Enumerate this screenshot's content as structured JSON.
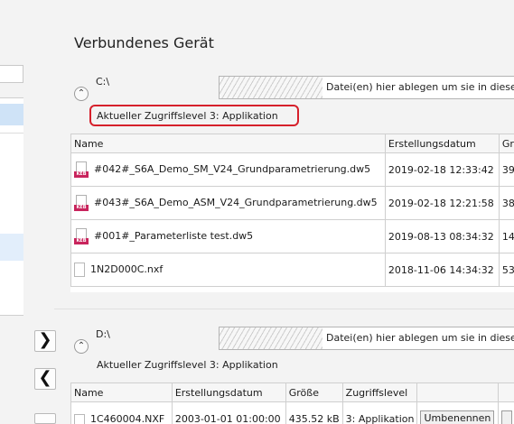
{
  "section": {
    "title": "Verbundenes Gerät"
  },
  "drive_c": {
    "label": "C:\\",
    "dropzone": "Datei(en) hier ablegen um sie in diese",
    "access_level": "Aktueller Zugriffslevel  3: Applikation",
    "columns": [
      "Name",
      "Erstellungsdatum",
      "Gr"
    ],
    "files": [
      {
        "name": "#042#_S6A_Demo_SM_V24_Grundparametrierung.dw5",
        "date": "2019-02-18 12:33:42",
        "size": "39",
        "icon": "kebasys-file-icon"
      },
      {
        "name": "#043#_S6A_Demo_ASM_V24_Grundparametrierung.dw5",
        "date": "2019-02-18 12:21:58",
        "size": "38",
        "icon": "kebasys-file-icon"
      },
      {
        "name": "#001#_Parameterliste test.dw5",
        "date": "2019-08-13 08:34:32",
        "size": "14",
        "icon": "kebasys-file-icon"
      },
      {
        "name": "1N2D000C.nxf",
        "date": "2018-11-06 14:34:32",
        "size": "53",
        "icon": "blank-file-icon"
      }
    ]
  },
  "drive_d": {
    "label": "D:\\",
    "dropzone": "Datei(en) hier ablegen um sie in diese",
    "access_level": "Aktueller Zugriffslevel  3: Applikation",
    "columns": [
      "Name",
      "Erstellungsdatum",
      "Größe",
      "Zugriffslevel"
    ],
    "files": [
      {
        "name": "1C460004.NXF",
        "date": "2003-01-01 01:00:00",
        "size": "435.52 kB",
        "level": "3: Applikation",
        "action": "Umbenennen"
      }
    ]
  },
  "nav": {
    "forward_icon": "chevron-right-icon",
    "back_icon": "chevron-left-icon",
    "forward": "❯",
    "back": "❮"
  },
  "icons": {
    "collapse": "chevron-up-icon",
    "collapse_glyph": "⌃",
    "file_tag": "KEB"
  },
  "colors": {
    "highlight_frame": "#d6202b",
    "file_tag": "#c8245c",
    "selection": "#cfe3f7"
  }
}
